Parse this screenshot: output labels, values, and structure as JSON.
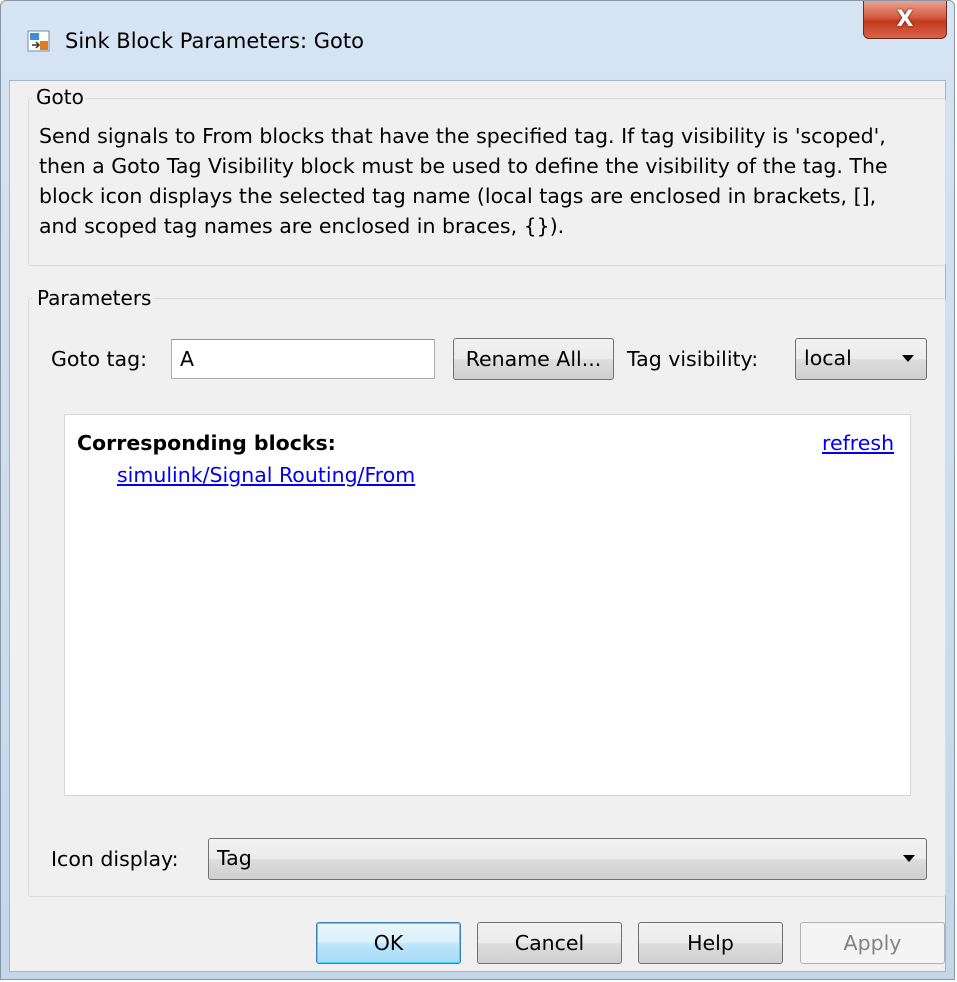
{
  "window": {
    "title": "Sink Block Parameters: Goto",
    "close_symbol": "X"
  },
  "goto_group": {
    "title": "Goto",
    "description": "Send signals to From blocks that have the specified tag.  If tag visibility is 'scoped', then a Goto Tag Visibility block must be used to define the visibility of the tag.  The block icon displays the selected tag name (local tags are enclosed in brackets, [], and scoped tag names are enclosed in braces, {})."
  },
  "parameters": {
    "title": "Parameters",
    "goto_tag_label": "Goto tag:",
    "goto_tag_value": "A",
    "rename_all_label": "Rename All...",
    "tag_visibility_label": "Tag visibility:",
    "tag_visibility_value": "local",
    "corresponding_blocks_heading": "Corresponding blocks:",
    "refresh_link": "refresh",
    "corresponding_blocks": [
      "simulink/Signal Routing/From"
    ],
    "icon_display_label": "Icon display:",
    "icon_display_value": "Tag"
  },
  "buttons": {
    "ok": "OK",
    "cancel": "Cancel",
    "help": "Help",
    "apply": "Apply"
  },
  "colors": {
    "link": "#0000ee",
    "close_button": "#c2391b",
    "default_button_border": "#3c7fb1"
  },
  "icons": {
    "app": "simulink-block-icon",
    "dropdown": "chevron-down-icon"
  }
}
